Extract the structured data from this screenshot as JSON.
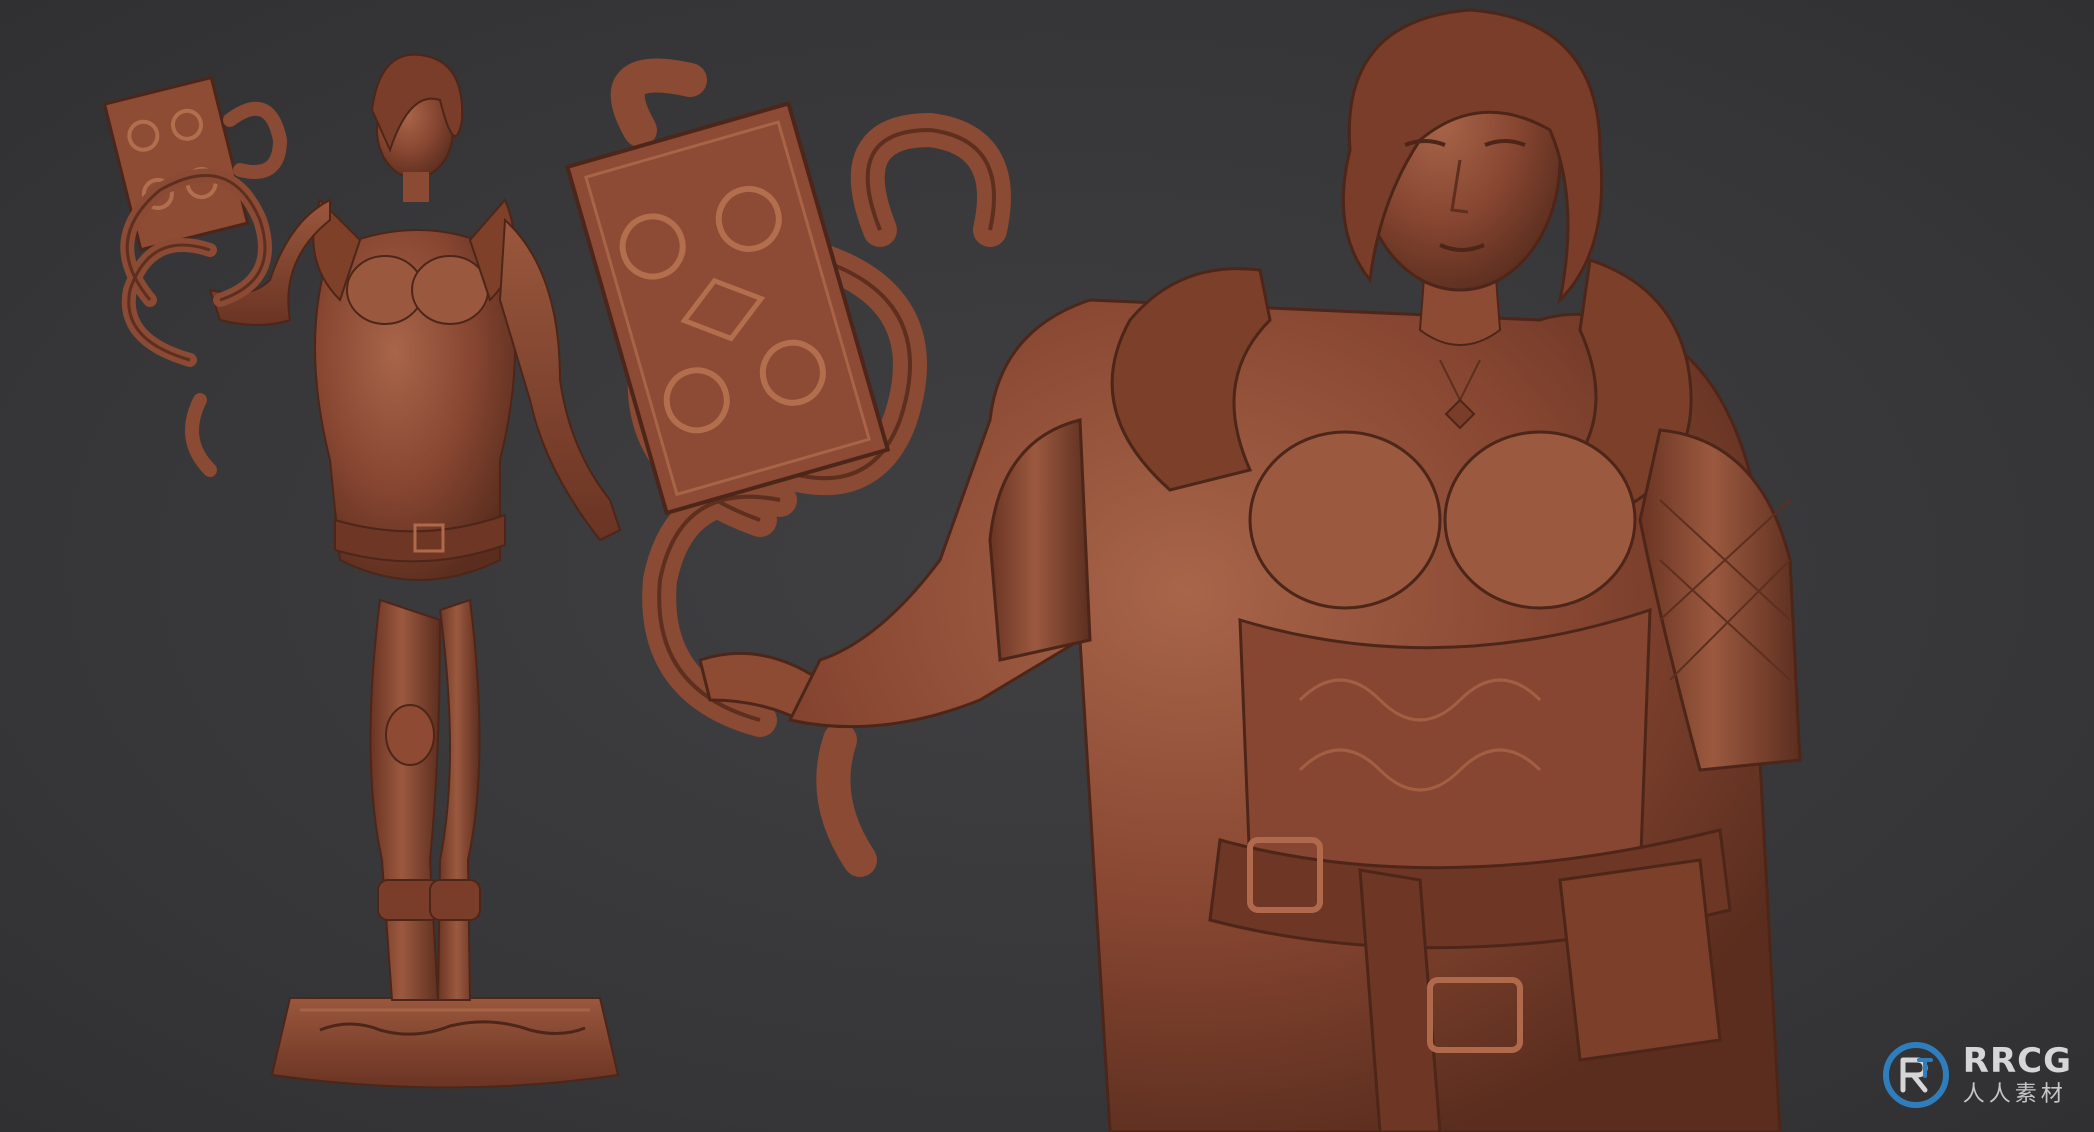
{
  "image": {
    "background_color": "#3a3a3c",
    "clay_color": "#8a4a33",
    "clay_shadow": "#5e2f1f",
    "clay_highlight": "#a86447"
  },
  "watermark": {
    "brand": "RRCG",
    "subtitle": "人人素材",
    "logo_icon": "rrcg-logo-icon",
    "accent_color": "#2f86c9"
  }
}
